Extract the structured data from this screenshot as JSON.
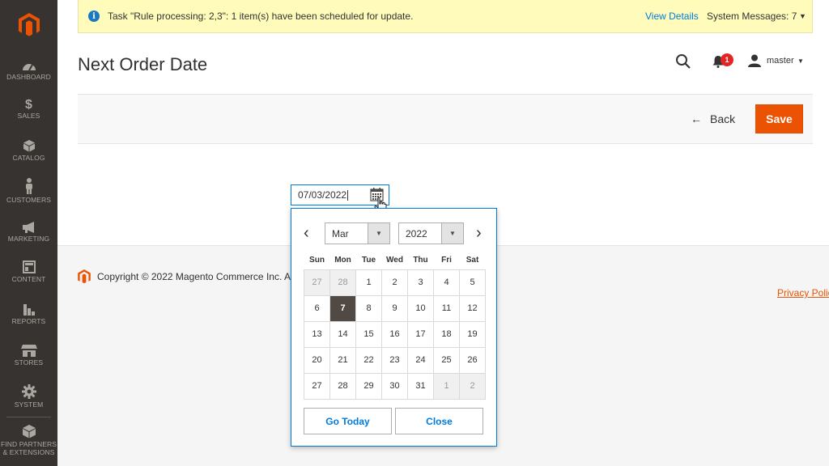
{
  "sidebar": {
    "items": [
      {
        "label": "DASHBOARD",
        "icon": "dashboard-icon"
      },
      {
        "label": "SALES",
        "icon": "dollar-icon"
      },
      {
        "label": "CATALOG",
        "icon": "box-icon"
      },
      {
        "label": "CUSTOMERS",
        "icon": "person-icon"
      },
      {
        "label": "MARKETING",
        "icon": "megaphone-icon"
      },
      {
        "label": "CONTENT",
        "icon": "layout-icon"
      },
      {
        "label": "REPORTS",
        "icon": "bar-chart-icon"
      },
      {
        "label": "STORES",
        "icon": "storefront-icon"
      },
      {
        "label": "SYSTEM",
        "icon": "gear-icon"
      },
      {
        "label_line1": "FIND PARTNERS",
        "label_line2": "& EXTENSIONS",
        "icon": "cube-icon"
      }
    ]
  },
  "message": {
    "text": "Task \"Rule processing: 2,3\": 1 item(s) have been scheduled for update.",
    "view_details": "View Details",
    "system_messages": "System Messages: 7"
  },
  "header": {
    "title": "Next Order Date",
    "notification_count": "1",
    "user": "master"
  },
  "actions": {
    "back_label": "Back",
    "save_label": "Save"
  },
  "date_field": {
    "value": "07/03/2022"
  },
  "datepicker": {
    "month": "Mar",
    "year": "2022",
    "weekdays": [
      "Sun",
      "Mon",
      "Tue",
      "Wed",
      "Thu",
      "Fri",
      "Sat"
    ],
    "weeks": [
      [
        {
          "d": "27",
          "o": true
        },
        {
          "d": "28",
          "o": true
        },
        {
          "d": "1"
        },
        {
          "d": "2"
        },
        {
          "d": "3"
        },
        {
          "d": "4"
        },
        {
          "d": "5"
        }
      ],
      [
        {
          "d": "6"
        },
        {
          "d": "7",
          "s": true
        },
        {
          "d": "8"
        },
        {
          "d": "9"
        },
        {
          "d": "10"
        },
        {
          "d": "11"
        },
        {
          "d": "12"
        }
      ],
      [
        {
          "d": "13"
        },
        {
          "d": "14"
        },
        {
          "d": "15"
        },
        {
          "d": "16"
        },
        {
          "d": "17"
        },
        {
          "d": "18"
        },
        {
          "d": "19"
        }
      ],
      [
        {
          "d": "20"
        },
        {
          "d": "21"
        },
        {
          "d": "22"
        },
        {
          "d": "23"
        },
        {
          "d": "24"
        },
        {
          "d": "25"
        },
        {
          "d": "26"
        }
      ],
      [
        {
          "d": "27"
        },
        {
          "d": "28"
        },
        {
          "d": "29"
        },
        {
          "d": "30"
        },
        {
          "d": "31"
        },
        {
          "d": "1",
          "o": true
        },
        {
          "d": "2",
          "o": true
        }
      ]
    ],
    "go_today": "Go Today",
    "close": "Close"
  },
  "footer": {
    "copyright": "Copyright © 2022 Magento Commerce Inc. Al",
    "privacy": "Privacy Polic"
  },
  "colors": {
    "accent": "#eb5202",
    "link": "#007bdb",
    "sidebar": "#373330",
    "message_bg": "#fffbbb"
  }
}
